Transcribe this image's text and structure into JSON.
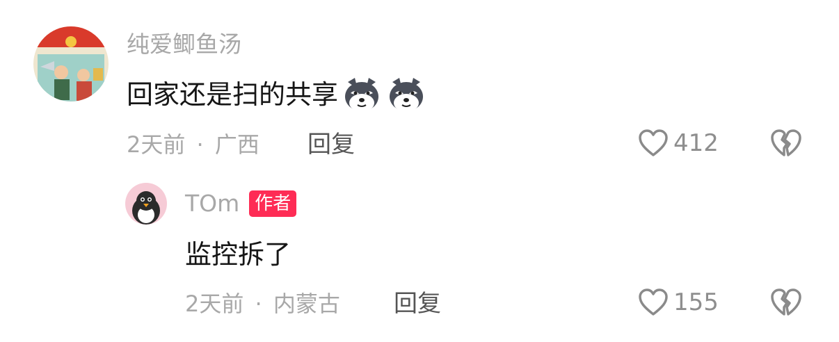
{
  "comments": [
    {
      "username": "纯爱鲫鱼汤",
      "text": "回家还是扫的共享",
      "emojis": [
        "husky-emoji",
        "husky-emoji"
      ],
      "time": "2天前",
      "separator": "·",
      "location": "广西",
      "reply_label": "回复",
      "like_count": "412"
    },
    {
      "username": "TOm",
      "badge": "作者",
      "text": "监控拆了",
      "time": "2天前",
      "separator": "·",
      "location": "内蒙古",
      "reply_label": "回复",
      "like_count": "155"
    }
  ],
  "colors": {
    "badge": "#fe2c55",
    "secondary_text": "#a8a8a8",
    "primary_text": "#161616"
  },
  "icons": {
    "like": "heart-outline-icon",
    "dislike": "broken-heart-icon"
  }
}
